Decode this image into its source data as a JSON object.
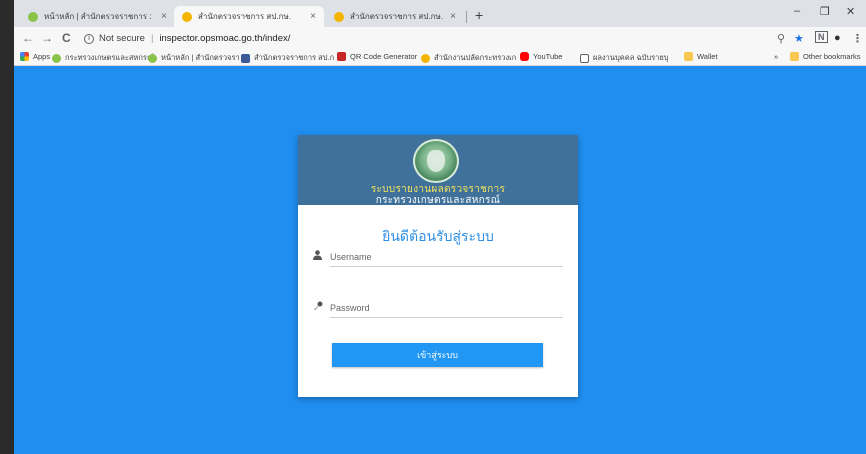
{
  "browser": {
    "tabs": [
      {
        "label": "หน้าหลัก | สำนักตรวจราชการ :",
        "active": false,
        "favicon_color": "#8bc34a"
      },
      {
        "label": "สำนักตรวจราชการ สป.กษ.",
        "active": true,
        "favicon_color": "#f4b400"
      },
      {
        "label": "สำนักตรวจราชการ สป.กษ.",
        "active": false,
        "favicon_color": "#f4b400"
      }
    ],
    "tab_close": "×",
    "new_tab": "+",
    "window_controls": {
      "minimize": "–",
      "maximize": "❐",
      "close": "✕"
    },
    "nav": {
      "back": "←",
      "forward": "→",
      "reload": "C"
    },
    "address": {
      "security": "Not secure",
      "info_glyph": "i",
      "url": "inspector.opsmoac.go.th/index/"
    },
    "toolbar_icons": {
      "zoom": "⚲",
      "star": "★",
      "extension": "N",
      "profile": "●",
      "menu": "⋮"
    },
    "bookmarks": [
      {
        "label": "Apps",
        "color": "#e94235"
      },
      {
        "label": "กระทรวงเกษตรและสหกรณ์",
        "color": "#8bc34a"
      },
      {
        "label": "หน้าหลัก | สำนักตรวจรา",
        "color": "#8bc34a"
      },
      {
        "label": "สำนักตรวจราชการ สป.ก",
        "color": "#3b5998"
      },
      {
        "label": "QR Code Generator",
        "color": "#c62828"
      },
      {
        "label": "สำนักงานปลัดกระทรวงเก",
        "color": "#f4b400"
      },
      {
        "label": "YouTube",
        "color": "#ff0000"
      },
      {
        "label": "ผลงานบุคคล ฉบับรายบุ",
        "color": "#ffffff"
      },
      {
        "label": "Wallet",
        "color": "#f9c74f"
      }
    ],
    "bookmarks_overflow": "»",
    "other_bookmarks": "Other bookmarks"
  },
  "login": {
    "header_title": "ระบบรายงานผลตรวจราชการ",
    "header_subtitle": "กระทรวงเกษตรและสหกรณ์",
    "welcome": "ยินดีต้อนรับสู่ระบบ",
    "username_placeholder": "Username",
    "password_placeholder": "Password",
    "submit_label": "เข้าสู่ระบบ",
    "username_icon": "👤",
    "password_icon": "🔑"
  },
  "colors": {
    "page_background": "#1f8ef0",
    "header_background": "#3f719a",
    "accent": "#2196f3",
    "header_title": "#f2e35a"
  }
}
